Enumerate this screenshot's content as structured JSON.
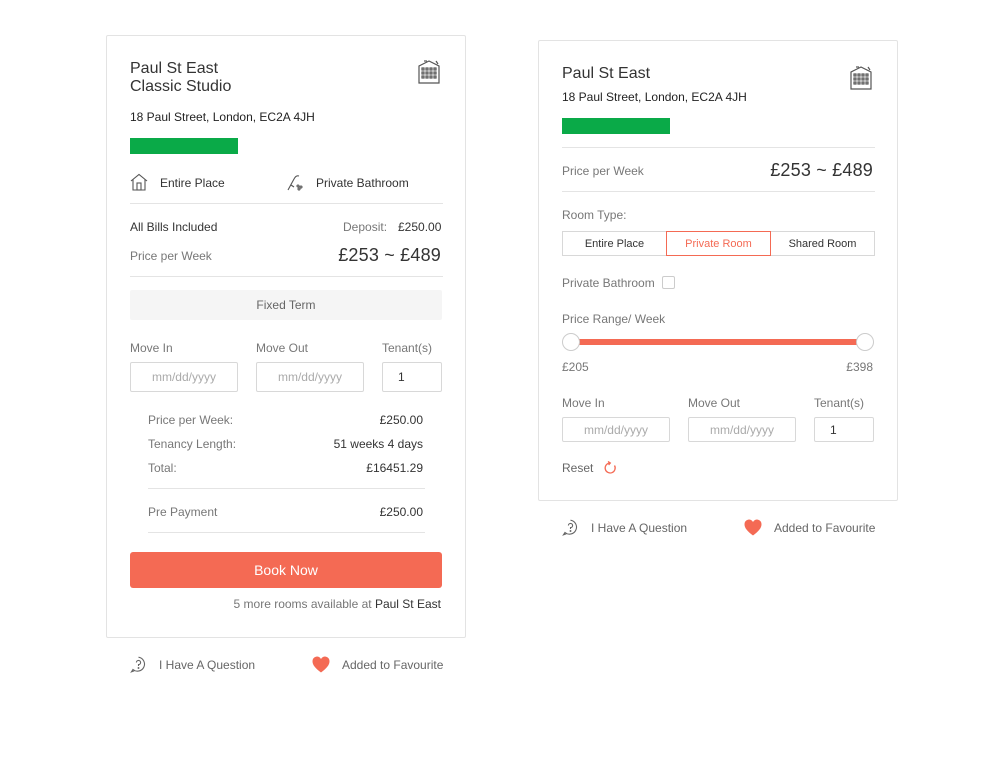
{
  "colors": {
    "accent": "#f46a54",
    "green": "#0aaa48"
  },
  "left": {
    "title_line1": "Paul St East",
    "title_line2": "Classic Studio",
    "address": "18 Paul Street, London, EC2A 4JH",
    "building_icon": "building-icon",
    "feature_entire_place": "Entire Place",
    "feature_private_bathroom": "Private Bathroom",
    "bills_included": "All Bills Included",
    "deposit_label": "Deposit:",
    "deposit_value": "£250.00",
    "price_per_week_label": "Price per Week",
    "price_range": "£253 ~ £489",
    "fixed_term": "Fixed Term",
    "move_in_label": "Move In",
    "move_out_label": "Move Out",
    "tenants_label": "Tenant(s)",
    "date_placeholder": "mm/dd/yyyy",
    "tenants_value": "1",
    "summary": {
      "ppw_label": "Price per Week:",
      "ppw_value": "£250.00",
      "tenancy_label": "Tenancy Length:",
      "tenancy_value": "51 weeks 4 days",
      "total_label": "Total:",
      "total_value": "£16451.29",
      "prepay_label": "Pre Payment",
      "prepay_value": "£250.00"
    },
    "book_now": "Book Now",
    "more_rooms_prefix": "5 more rooms available at",
    "more_rooms_place": "Paul St East",
    "question": "I Have A Question",
    "favourite": "Added to Favourite"
  },
  "right": {
    "title": "Paul St East",
    "address": "18 Paul Street, London, EC2A 4JH",
    "price_per_week_label": "Price per Week",
    "price_range": "£253 ~ £489",
    "room_type_label": "Room Type:",
    "room_types": [
      "Entire Place",
      "Private Room",
      "Shared Room"
    ],
    "room_type_selected": "Private Room",
    "private_bathroom_label": "Private Bathroom",
    "private_bathroom_checked": false,
    "price_range_label": "Price Range/ Week",
    "slider_min": "£205",
    "slider_max": "£398",
    "move_in_label": "Move In",
    "move_out_label": "Move Out",
    "tenants_label": "Tenant(s)",
    "date_placeholder": "mm/dd/yyyy",
    "tenants_value": "1",
    "reset": "Reset",
    "question": "I Have A Question",
    "favourite": "Added to Favourite"
  }
}
